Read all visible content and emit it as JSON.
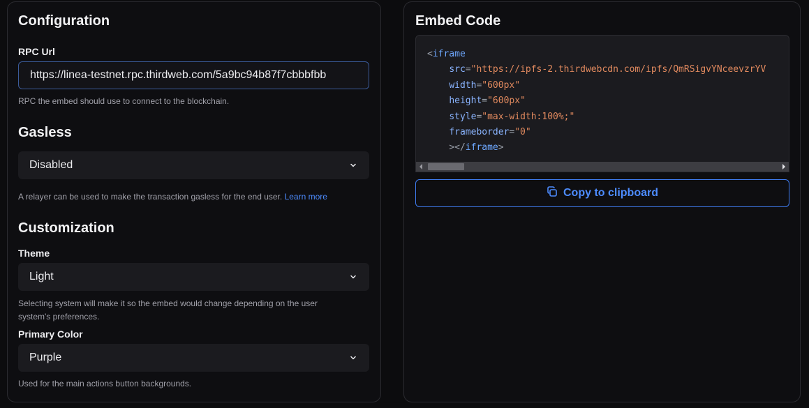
{
  "configuration": {
    "heading": "Configuration",
    "rpc": {
      "label": "RPC Url",
      "value": "https://linea-testnet.rpc.thirdweb.com/5a9bc94b87f7cbbbfbb",
      "help": "RPC the embed should use to connect to the blockchain."
    },
    "gasless": {
      "heading": "Gasless",
      "selected": "Disabled",
      "help": "A relayer can be used to make the transaction gasless for the end user.",
      "link": "Learn more"
    },
    "customization": {
      "heading": "Customization",
      "theme": {
        "label": "Theme",
        "selected": "Light",
        "help_line1": "Selecting system will make it so the embed would change depending on the user",
        "help_line2": "system's preferences."
      },
      "primary_color": {
        "label": "Primary Color",
        "selected": "Purple",
        "help": "Used for the main actions button backgrounds."
      }
    }
  },
  "embed": {
    "heading": "Embed Code",
    "code": {
      "tag_open": "iframe",
      "src_attr": "src",
      "src_value": "\"https://ipfs-2.thirdwebcdn.com/ipfs/QmRSigvYNceevzrYV",
      "width_attr": "width",
      "width_value": "\"600px\"",
      "height_attr": "height",
      "height_value": "\"600px\"",
      "style_attr": "style",
      "style_value": "\"max-width:100%;\"",
      "frameborder_attr": "frameborder",
      "frameborder_value": "\"0\"",
      "tag_close": "iframe"
    },
    "copy_label": "Copy to clipboard"
  },
  "colors": {
    "accent": "#4d8cff",
    "panel_border": "#2b2b30",
    "field_bg": "#1b1b1f",
    "string": "#e0895e",
    "attribute": "#8ab4ff"
  },
  "icons": {
    "select": "chevron-down-icon",
    "copy": "copy-icon",
    "scroll_left": "scroll-left-arrow-icon",
    "scroll_right": "scroll-right-arrow-icon"
  }
}
